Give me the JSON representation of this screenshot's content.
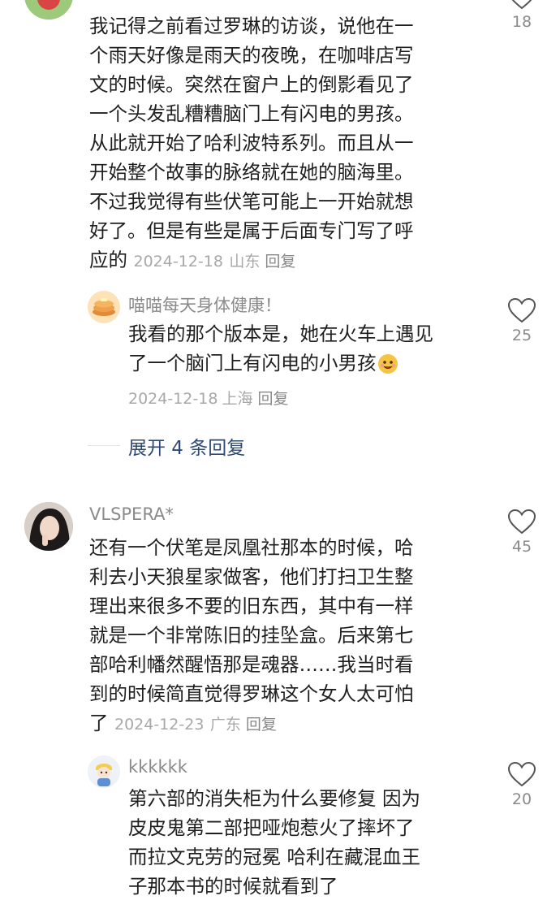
{
  "comments": [
    {
      "text": "我记得之前看过罗琳的访谈，说他在一\n个雨天好像是雨天的夜晚，在咖啡店写\n文的时候。突然在窗户上的倒影看见了\n一个头发乱糟糟脑门上有闪电的男孩。\n从此就开始了哈利波特系列。而且从一\n开始整个故事的脉络就在她的脑海里。\n不过我觉得有些伏笔可能上一开始就想\n好了。但是有些是属于后面专门写了呼\n应的",
      "date": "2024-12-18",
      "location": "山东",
      "reply_label": "回复",
      "likes": "18"
    },
    {
      "username": "喵喵每天身体健康！",
      "text": "我看的那个版本是，她在火车上遇见\n了一个脑门上有闪电的小男孩",
      "date": "2024-12-18",
      "location": "上海",
      "reply_label": "回复",
      "likes": "25"
    },
    {
      "username": "VLSPERA*",
      "text": "还有一个伏笔是凤凰社那本的时候，哈\n利去小天狼星家做客，他们打扫卫生整\n理出来很多不要的旧东西，其中有一样\n就是一个非常陈旧的挂坠盒。后来第七\n部哈利幡然醒悟那是魂器……我当时看\n到的时候简直觉得罗琳这个女人太可怕\n了",
      "date": "2024-12-23",
      "location": "广东",
      "reply_label": "回复",
      "likes": "45"
    },
    {
      "username": "kkkkkk",
      "text": "第六部的消失柜为什么要修复 因为\n皮皮鬼第二部把哑炮惹火了摔坏了\n而拉文克劳的冠冕 哈利在藏混血王\n子那本书的时候就看到了",
      "likes": "20"
    }
  ],
  "expand_replies": "展开 4 条回复",
  "colors": {
    "link": "#2e4a73",
    "meta": "#a8a8a8",
    "text": "#1f1f1f"
  }
}
